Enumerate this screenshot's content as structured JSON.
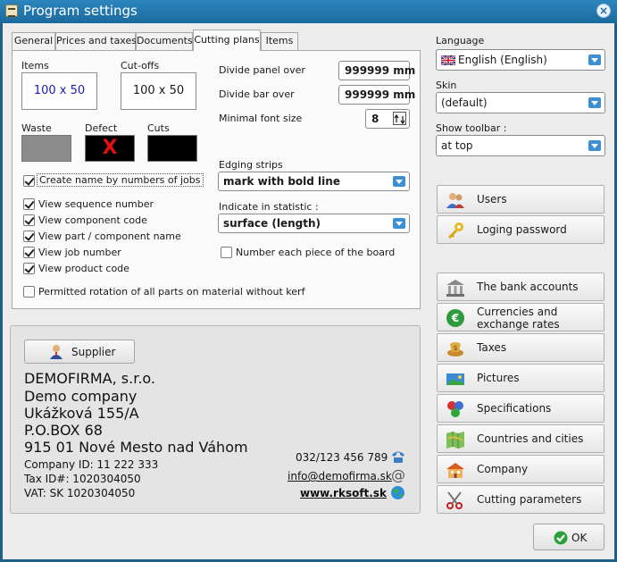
{
  "window": {
    "title": "Program settings",
    "close_label": "×"
  },
  "tabs": [
    "General",
    "Prices and taxes",
    "Documents",
    "Cutting plans",
    "Items"
  ],
  "cutting_plans": {
    "items_label": "Items",
    "items_sample": "100 x 50",
    "cutoffs_label": "Cut-offs",
    "cutoffs_sample": "100 x 50",
    "waste_label": "Waste",
    "defect_label": "Defect",
    "defect_mark": "X",
    "cuts_label": "Cuts",
    "divide_panel_label": "Divide panel over",
    "divide_panel_value": "999999 mm",
    "divide_bar_label": "Divide bar over",
    "divide_bar_value": "999999 mm",
    "min_font_label": "Minimal font size",
    "min_font_value": "8",
    "edging_label": "Edging strips",
    "edging_value": "mark with bold line",
    "statistic_label": "Indicate in statistic :",
    "statistic_value": "surface (length)",
    "number_each_label": "Number each piece of the board",
    "create_name_label": "Create name by numbers of jobs",
    "checkboxes": [
      {
        "label": "View sequence number",
        "checked": true
      },
      {
        "label": "View component code",
        "checked": true
      },
      {
        "label": "View part / component name",
        "checked": true
      },
      {
        "label": "View job number",
        "checked": true
      },
      {
        "label": "View product code",
        "checked": true
      }
    ],
    "permitted_rotation_label": "Permitted rotation of all parts on material without kerf",
    "colors": {
      "items_text": "#1a1ab8",
      "waste": "#8c8c8c",
      "defect_bg": "#000000",
      "defect_mark": "#e01010",
      "cuts": "#000000"
    }
  },
  "right": {
    "language_label": "Language",
    "language_value": "English (English)",
    "skin_label": "Skin",
    "skin_value": "(default)",
    "toolbar_label": "Show toolbar :",
    "toolbar_value": "at top",
    "buttons": [
      {
        "label": "Users",
        "icon": "users-icon"
      },
      {
        "label": "Loging password",
        "icon": "key-icon"
      },
      {
        "label": "The bank accounts",
        "icon": "bank-icon"
      },
      {
        "label": "Currencies and exchange rates",
        "icon": "euro-icon"
      },
      {
        "label": "Taxes",
        "icon": "money-icon"
      },
      {
        "label": "Pictures",
        "icon": "picture-icon"
      },
      {
        "label": "Specifications",
        "icon": "specifications-icon"
      },
      {
        "label": "Countries and cities",
        "icon": "map-icon"
      },
      {
        "label": "Company",
        "icon": "company-icon"
      },
      {
        "label": "Cutting parameters",
        "icon": "scissors-icon"
      }
    ],
    "ok_label": "OK"
  },
  "supplier": {
    "button_label": "Supplier",
    "lines": [
      "DEMOFIRMA, s.r.o.",
      "Demo company",
      "Ukážková 155/A",
      "P.O.BOX 68",
      "915 01  Nové Mesto nad Váhom"
    ],
    "company_id": "Company ID: 11 222 333",
    "tax_id": "Tax ID#: 1020304050",
    "vat": "VAT: SK 1020304050",
    "phone": "032/123 456 789",
    "email": "info@demofirma.sk",
    "web": "www.rksoft.sk"
  }
}
